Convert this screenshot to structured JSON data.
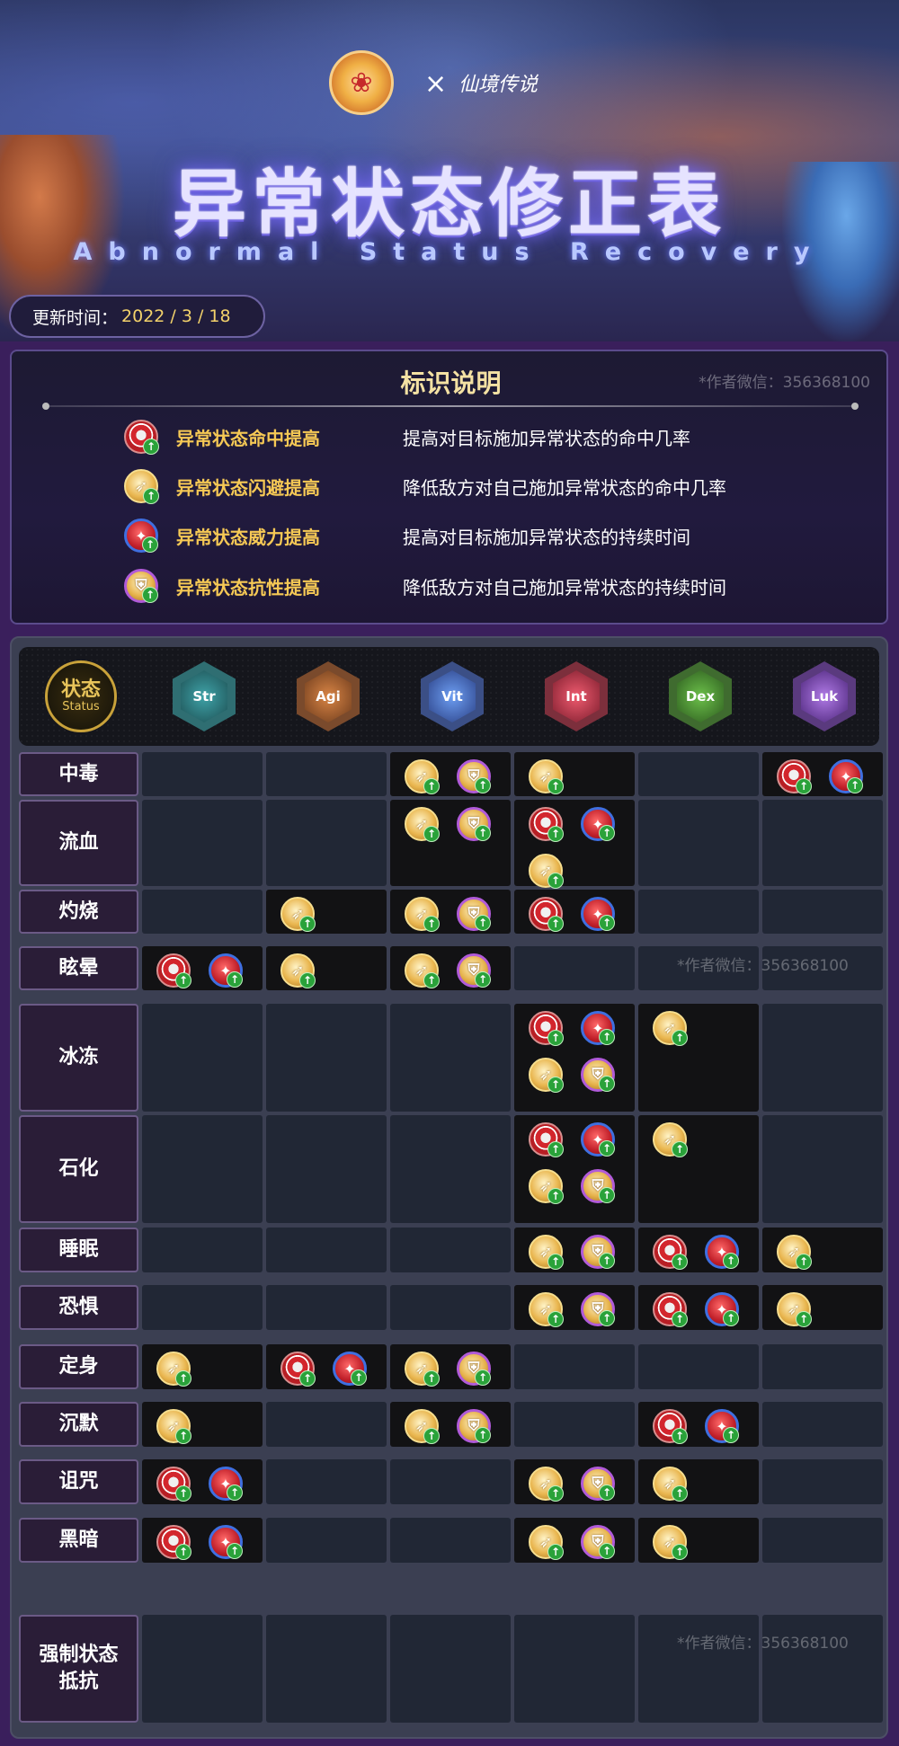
{
  "header": {
    "logo_x": "×",
    "game_logo_text": "仙境传说",
    "title": "异常状态修正表",
    "subtitle": "Abnormal Status Recovery",
    "update_label": "更新时间：",
    "update_value": "2022 / 3 / 18"
  },
  "legend": {
    "title": "标识说明",
    "watermark": "*作者微信：356368100",
    "items": [
      {
        "icon": "hit-up-icon",
        "name": "异常状态命中提高",
        "desc": "提高对目标施加异常状态的命中几率"
      },
      {
        "icon": "evade-up-icon",
        "name": "异常状态闪避提高",
        "desc": "降低敌方对自己施加异常状态的命中几率"
      },
      {
        "icon": "power-up-icon",
        "name": "异常状态威力提高",
        "desc": "提高对目标施加异常状态的持续时间"
      },
      {
        "icon": "resist-up-icon",
        "name": "异常状态抗性提高",
        "desc": "降低敌方对自己施加异常状态的持续时间"
      }
    ]
  },
  "table": {
    "status_zh": "状态",
    "status_en": "Status",
    "stats": [
      "Str",
      "Agi",
      "Vit",
      "Int",
      "Dex",
      "Luk"
    ],
    "watermark": "*作者微信：356368100",
    "rows": [
      {
        "name": "中毒",
        "cells": [
          [],
          [],
          [
            "evade",
            "resist"
          ],
          [
            "evade"
          ],
          [],
          [
            "hit",
            "power"
          ]
        ]
      },
      {
        "name": "流血",
        "cells": [
          [],
          [],
          [
            "evade",
            "resist"
          ],
          [
            "hit",
            "power",
            "evade"
          ],
          [],
          []
        ]
      },
      {
        "name": "灼烧",
        "cells": [
          [],
          [
            "evade"
          ],
          [
            "evade",
            "resist"
          ],
          [
            "hit",
            "power"
          ],
          [],
          []
        ]
      },
      {
        "name": "眩晕",
        "cells": [
          [
            "hit",
            "power"
          ],
          [
            "evade"
          ],
          [
            "evade",
            "resist"
          ],
          [],
          [],
          []
        ]
      },
      {
        "name": "冰冻",
        "cells": [
          [],
          [],
          [],
          [
            "hit",
            "power",
            "evade",
            "resist"
          ],
          [
            "evade"
          ],
          []
        ]
      },
      {
        "name": "石化",
        "cells": [
          [],
          [],
          [],
          [
            "hit",
            "power",
            "evade",
            "resist"
          ],
          [
            "evade"
          ],
          []
        ]
      },
      {
        "name": "睡眠",
        "cells": [
          [],
          [],
          [],
          [
            "evade",
            "resist"
          ],
          [
            "hit",
            "power"
          ],
          [
            "evade"
          ]
        ]
      },
      {
        "name": "恐惧",
        "cells": [
          [],
          [],
          [],
          [
            "evade",
            "resist"
          ],
          [
            "hit",
            "power"
          ],
          [
            "evade"
          ]
        ]
      },
      {
        "name": "定身",
        "cells": [
          [
            "evade"
          ],
          [
            "hit",
            "power"
          ],
          [
            "evade",
            "resist"
          ],
          [],
          [],
          []
        ]
      },
      {
        "name": "沉默",
        "cells": [
          [
            "evade"
          ],
          [],
          [
            "evade",
            "resist"
          ],
          [],
          [
            "hit",
            "power"
          ],
          []
        ]
      },
      {
        "name": "诅咒",
        "cells": [
          [
            "hit",
            "power"
          ],
          [],
          [],
          [
            "evade",
            "resist"
          ],
          [
            "evade"
          ],
          []
        ]
      },
      {
        "name": "黑暗",
        "cells": [
          [
            "hit",
            "power"
          ],
          [],
          [],
          [
            "evade",
            "resist"
          ],
          [
            "evade"
          ],
          []
        ]
      },
      {
        "name": "强制状态\n抵抗",
        "cells": [
          [],
          [],
          [],
          [],
          [],
          []
        ]
      }
    ]
  },
  "colors": {
    "accent_gold": "#f6c955",
    "title_glow": "#7f74ff",
    "cell_filled": "#121214",
    "cell_empty": "#212735"
  }
}
